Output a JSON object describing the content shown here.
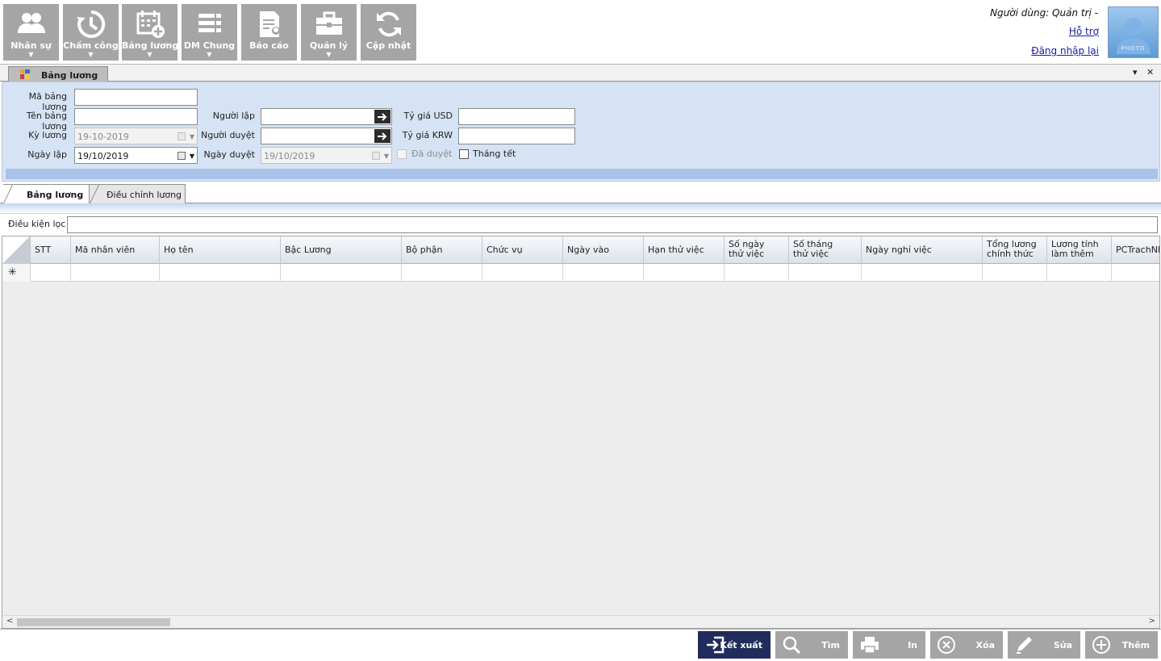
{
  "toolbar": {
    "buttons": [
      {
        "label": "Nhân sự",
        "icon": "people-icon"
      },
      {
        "label": "Chấm công",
        "icon": "clock-history-icon"
      },
      {
        "label": "Bảng lương",
        "icon": "calendar-add-icon"
      },
      {
        "label": "DM Chung",
        "icon": "list-icon"
      },
      {
        "label": "Báo cáo",
        "icon": "report-icon"
      },
      {
        "label": "Quản lý",
        "icon": "briefcase-icon"
      },
      {
        "label": "Cập nhật",
        "icon": "refresh-icon"
      }
    ],
    "caret": "▼"
  },
  "user": {
    "line": "Người dùng: Quản trị -",
    "help": "Hỗ trợ",
    "relogin": "Đăng nhập lại",
    "photo_text": "PHOTO"
  },
  "document_tab": {
    "title": "Bảng lương",
    "dropdown_glyph": "▾",
    "close_glyph": "✕"
  },
  "form": {
    "ma_bang_luong": {
      "label": "Mã bảng lương",
      "value": ""
    },
    "ten_bang_luong": {
      "label": "Tên bảng lương",
      "value": ""
    },
    "ky_luong": {
      "label": "Kỳ lương",
      "value": "19-10-2019"
    },
    "ngay_lap": {
      "label": "Ngày lập",
      "value": "19/10/2019"
    },
    "nguoi_lap": {
      "label": "Người lập",
      "value": ""
    },
    "nguoi_duyet": {
      "label": "Người duyệt",
      "value": ""
    },
    "ngay_duyet": {
      "label": "Ngày duyệt",
      "value": "19/10/2019"
    },
    "ty_gia_usd": {
      "label": "Tỷ giá USD",
      "value": ""
    },
    "ty_gia_krw": {
      "label": "Tỷ giá KRW",
      "value": ""
    },
    "da_duyet": {
      "label": "Đã duyệt",
      "checked": false
    },
    "thang_tet": {
      "label": "Tháng tết",
      "checked": false
    }
  },
  "inner_tabs": [
    {
      "label": "Bảng lương",
      "active": true
    },
    {
      "label": "Điều chỉnh lương",
      "active": false
    }
  ],
  "filter": {
    "label": "Điều kiện lọc",
    "value": ""
  },
  "grid": {
    "columns": [
      "STT",
      "Mã nhân viên",
      "Họ tên",
      "Bậc Lương",
      "Bộ phận",
      "Chức vụ",
      "Ngày vào",
      "Hạn thử việc",
      "Số ngày thử việc",
      "Số tháng thử việc",
      "Ngày nghỉ việc",
      "Tổng lương chính thức",
      "Lương tính làm thêm",
      "PCTrachNhiem"
    ],
    "new_row_glyph": "✳"
  },
  "actions": [
    {
      "label": "Kết xuất",
      "icon": "export-icon"
    },
    {
      "label": "Tìm",
      "icon": "search-icon"
    },
    {
      "label": "In",
      "icon": "printer-icon"
    },
    {
      "label": "Xóa",
      "icon": "delete-icon"
    },
    {
      "label": "Sửa",
      "icon": "edit-icon"
    },
    {
      "label": "Thêm",
      "icon": "add-icon"
    }
  ],
  "colors": {
    "toolbar_button": "#a5a5a5",
    "form_panel": "#d6e3f4",
    "primary_action": "#1f2c5c",
    "link": "#1a1aa6"
  }
}
